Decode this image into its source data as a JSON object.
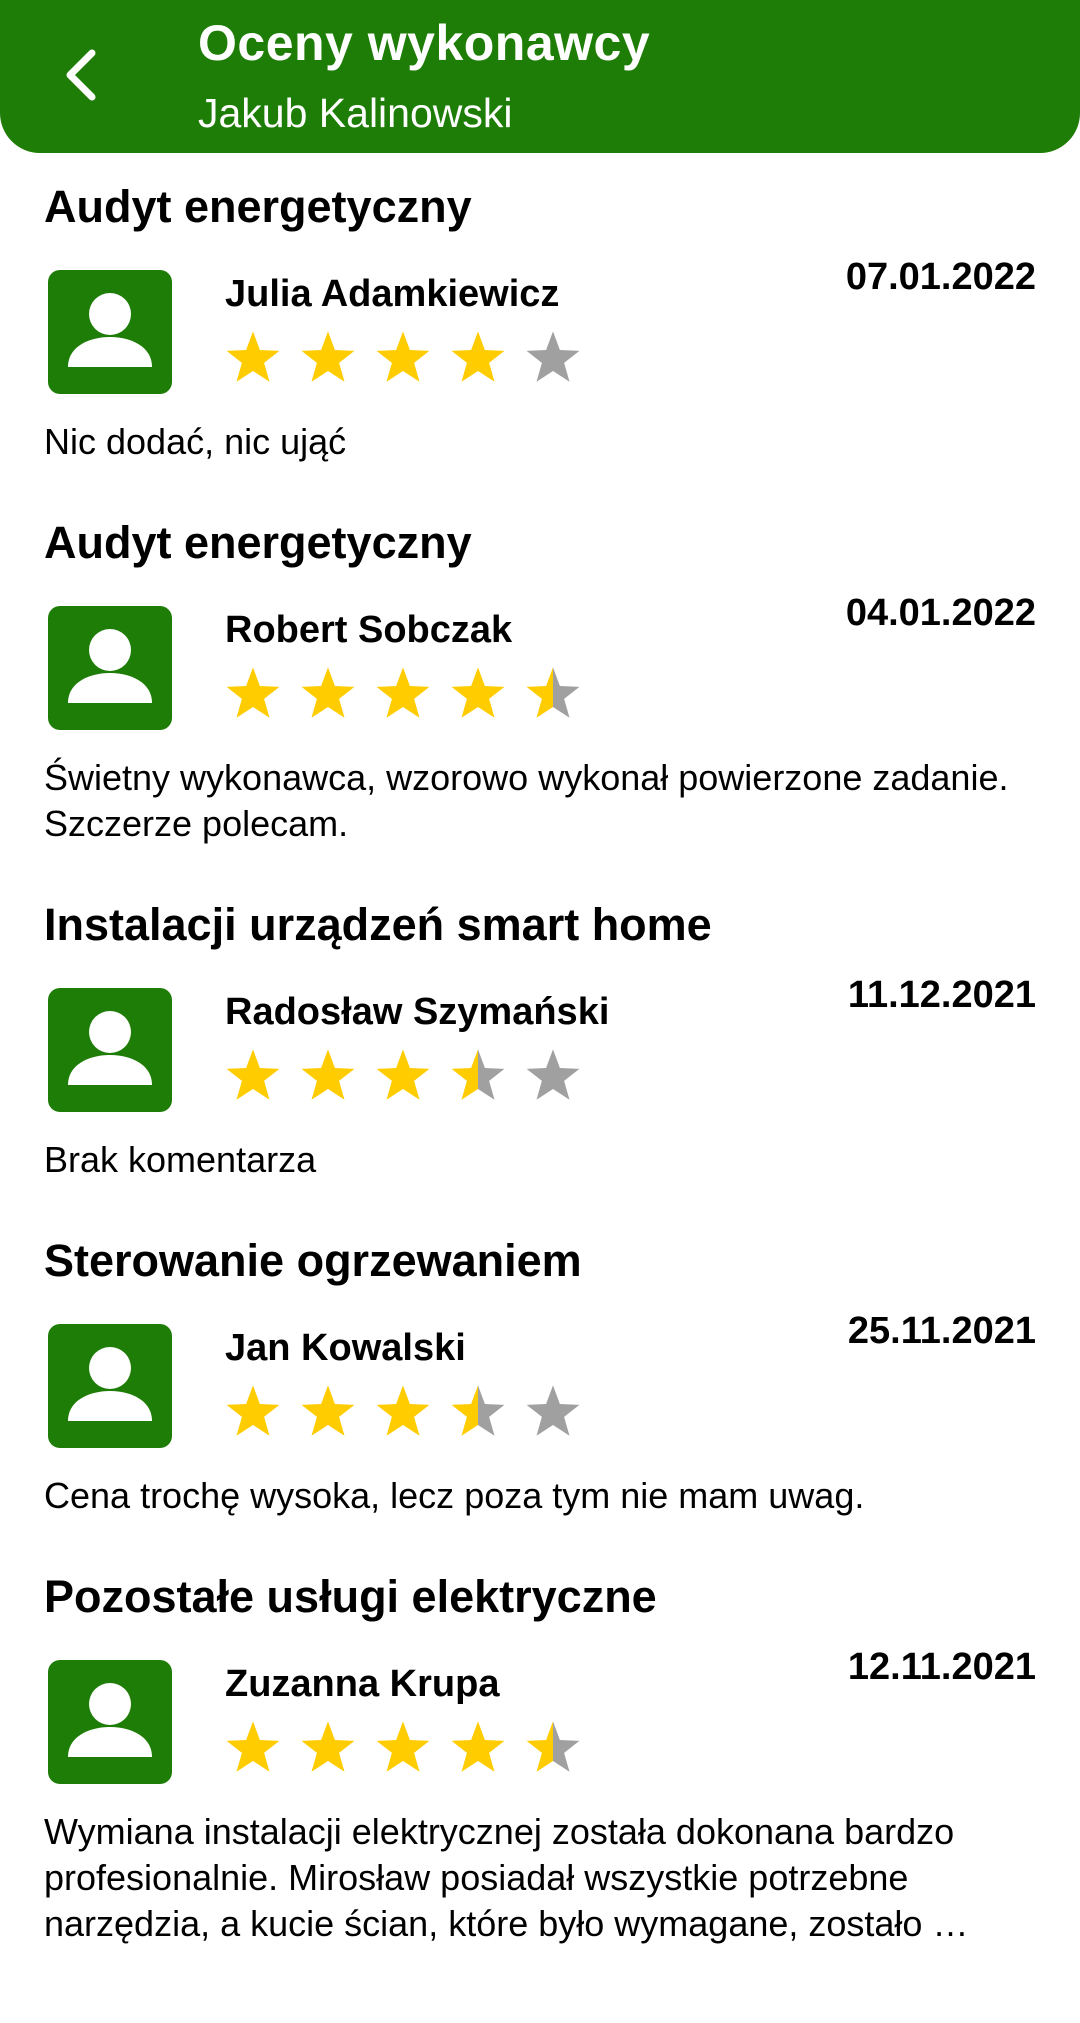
{
  "header": {
    "title": "Oceny wykonawcy",
    "subtitle": "Jakub Kalinowski",
    "back_icon": "chevron-left-icon",
    "background_color": "#1e7d07"
  },
  "colors": {
    "star_filled": "#ffcc00",
    "star_empty": "#a0a0a0",
    "avatar_background": "#1e7d07"
  },
  "reviews": [
    {
      "service": "Audyt energetyczny",
      "reviewer": "Julia Adamkiewicz",
      "date": "07.01.2022",
      "rating": 4,
      "rating_max": 5,
      "comment": "Nic dodać, nic ująć"
    },
    {
      "service": "Audyt energetyczny",
      "reviewer": "Robert Sobczak",
      "date": "04.01.2022",
      "rating": 4.5,
      "rating_max": 5,
      "comment": "Świetny wykonawca, wzorowo wykonał powierzone zadanie. Szczerze polecam."
    },
    {
      "service": "Instalacji urządzeń smart home",
      "reviewer": "Radosław Szymański",
      "date": "11.12.2021",
      "rating": 3.5,
      "rating_max": 5,
      "comment": "Brak komentarza"
    },
    {
      "service": "Sterowanie ogrzewaniem",
      "reviewer": "Jan Kowalski",
      "date": "25.11.2021",
      "rating": 3.5,
      "rating_max": 5,
      "comment": "Cena trochę wysoka, lecz poza tym nie mam uwag."
    },
    {
      "service": "Pozostałe usługi elektryczne",
      "reviewer": "Zuzanna Krupa",
      "date": "12.11.2021",
      "rating": 4.5,
      "rating_max": 5,
      "comment": "Wymiana instalacji elektrycznej została dokonana bardzo profesionalnie. Mirosław posiadał wszystkie potrzebne narzędzia, a kucie ścian, które było wymagane, zostało …"
    }
  ]
}
